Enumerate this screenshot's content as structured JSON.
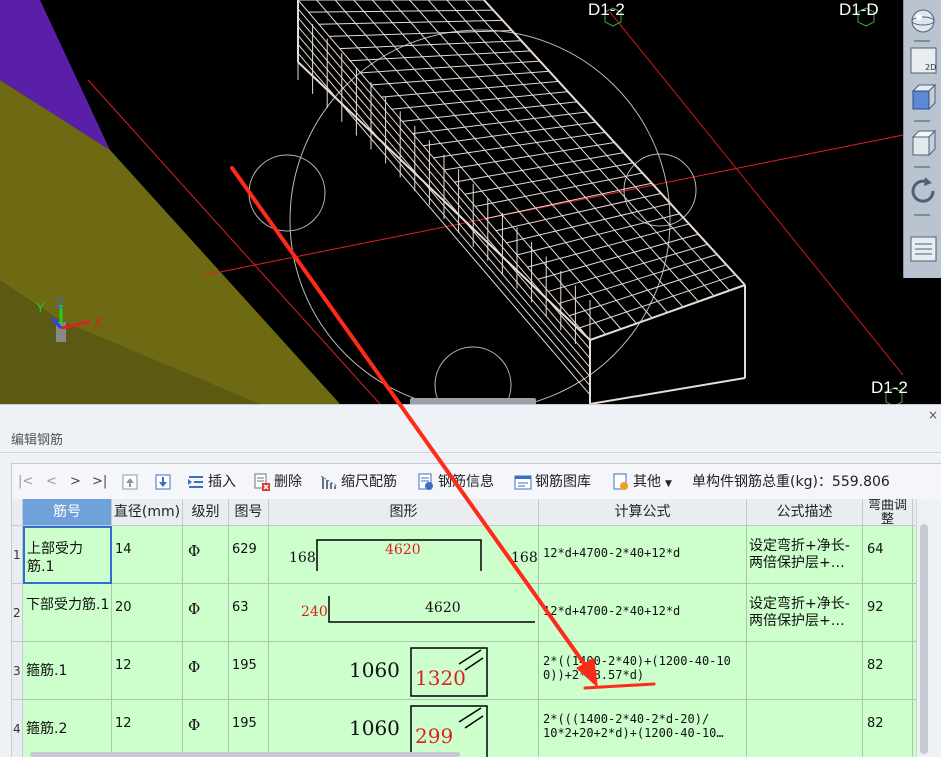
{
  "viewport": {
    "axis_labels": [
      "D1-2",
      "D1-D",
      "D1-2"
    ],
    "gizmo": {
      "y": "Y",
      "z": "Z",
      "x": "X"
    },
    "toolbar_buttons": [
      "sphere-icon",
      "2d-view-icon",
      "cube-front-icon",
      "cube-icon",
      "rotate-icon",
      "ruler-icon"
    ],
    "toolbar_2d_label": "2D"
  },
  "panel": {
    "close": "×",
    "title": "编辑钢筋"
  },
  "toolbar": {
    "nav_first": "|<",
    "nav_prev": "<",
    "nav_next": ">",
    "nav_last": ">|",
    "insert": "插入",
    "delete": "删除",
    "scale_rebar": "缩尺配筋",
    "rebar_info": "钢筋信息",
    "rebar_library": "钢筋图库",
    "other": "其他",
    "total_weight": "单构件钢筋总重(kg)：559.806"
  },
  "table": {
    "headers": {
      "name": "筋号",
      "diameter": "直径(mm)",
      "grade": "级别",
      "shape_no": "图号",
      "shape": "图形",
      "formula": "计算公式",
      "desc": "公式描述",
      "bend": "弯曲调整"
    },
    "rows": [
      {
        "num": "1",
        "name": "上部受力筋.1",
        "diameter": "14",
        "grade": "Φ",
        "shape_no": "629",
        "shape_left": "168",
        "shape_mid": "4620",
        "shape_right": "168",
        "formula": "12*d+4700-2*40+12*d",
        "desc": "设定弯折+净长-两倍保护层+…",
        "bend": "64"
      },
      {
        "num": "2",
        "name": "下部受力筋.1",
        "diameter": "20",
        "grade": "Φ",
        "shape_no": "63",
        "shape_left": "240",
        "shape_mid": "4620",
        "formula": "12*d+4700-2*40+12*d",
        "desc": "设定弯折+净长-两倍保护层+…",
        "bend": "92"
      },
      {
        "num": "3",
        "name": "箍筋.1",
        "diameter": "12",
        "grade": "Φ",
        "shape_no": "195",
        "shape_left": "1060",
        "shape_inner": "1320",
        "formula": "2*((1400-2*40)+(1200-40-10\n0))+2*(8.57*d)",
        "desc": "",
        "bend": "82"
      },
      {
        "num": "4",
        "name": "箍筋.2",
        "diameter": "12",
        "grade": "Φ",
        "shape_no": "195",
        "shape_left": "1060",
        "shape_inner": "299",
        "formula": "2*(((1400-2*40-2*d-20)/\n10*2+20+2*d)+(1200-40-10…",
        "desc": "",
        "bend": "82"
      }
    ]
  },
  "colors": {
    "viewport_bg": "#000000",
    "row_bg": "#ccffcc",
    "header_selected": "#6fa1da",
    "annotation": "#ff2a1a"
  }
}
